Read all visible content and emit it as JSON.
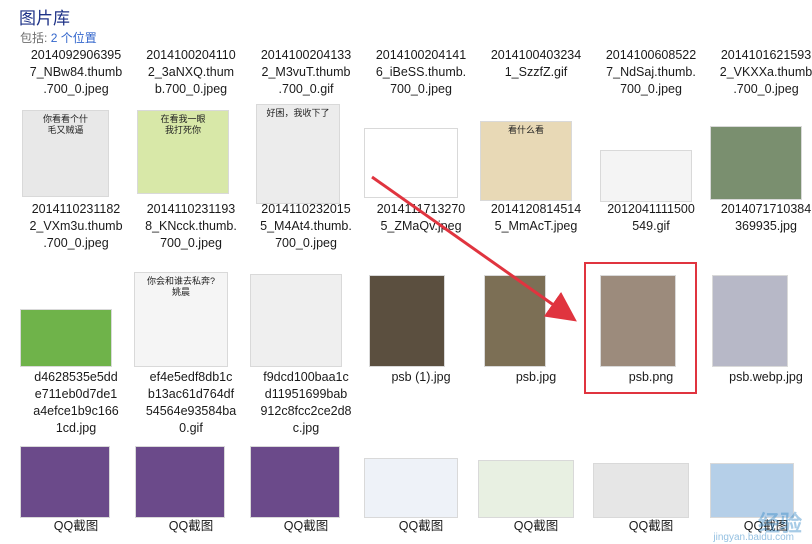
{
  "header": {
    "title": "图片库",
    "includes_prefix": "包括:",
    "includes_link": "2 个位置"
  },
  "row1": [
    {
      "caption": "2014092906395\n7_NBw84.thumb\n.700_0.jpeg"
    },
    {
      "caption": "2014100204110\n2_3aNXQ.thum\nb.700_0.jpeg"
    },
    {
      "caption": "2014100204133\n2_M3vuT.thumb\n.700_0.gif"
    },
    {
      "caption": "2014100204141\n6_iBeSS.thumb.\n700_0.jpeg"
    },
    {
      "caption": "2014100403234\n1_SzzfZ.gif"
    },
    {
      "caption": "2014100608522\n7_NdSaj.thumb.\n700_0.jpeg"
    },
    {
      "caption": "2014101621593\n2_VKXXa.thumb\n.700_0.jpeg"
    }
  ],
  "row2": [
    {
      "caption": "2014110231182\n2_VXm3u.thumb\n.700_0.jpeg",
      "text": "你看看个什\n毛又贼逼"
    },
    {
      "caption": "2014110231193\n8_KNcck.thumb.\n700_0.jpeg",
      "text": "在看我一眼\n我打死你"
    },
    {
      "caption": "2014110232015\n5_M4At4.thumb.\n700_0.jpeg",
      "text": "好困，我收下了"
    },
    {
      "caption": "2014111713270\n5_ZMaQv.jpeg",
      "text": ""
    },
    {
      "caption": "2014120814514\n5_MmAcT.jpeg",
      "text": "看什么看"
    },
    {
      "caption": "2012041111500\n549.gif",
      "text": ""
    },
    {
      "caption": "2014071710384\n369935.jpg",
      "text": ""
    }
  ],
  "row3": [
    {
      "caption": "d4628535e5dd\ne711eb0d7de1\na4efce1b9c166\n1cd.jpg",
      "text": ""
    },
    {
      "caption": "ef4e5edf8db1c\nb13ac61d764df\n54564e93584ba\n0.gif",
      "text": "你会和谁去私奔?\n姚晨"
    },
    {
      "caption": "f9dcd100baa1c\nd11951699bab\n912c8fcc2ce2d8\nc.jpg",
      "text": ""
    },
    {
      "caption": "psb (1).jpg",
      "text": ""
    },
    {
      "caption": "psb.jpg",
      "text": ""
    },
    {
      "caption": "psb.png",
      "text": ""
    },
    {
      "caption": "psb.webp.jpg",
      "text": ""
    }
  ],
  "row4": [
    {
      "caption": "QQ截图"
    },
    {
      "caption": "QQ截图"
    },
    {
      "caption": "QQ截图"
    },
    {
      "caption": "QQ截图"
    },
    {
      "caption": "QQ截图"
    },
    {
      "caption": "QQ截图"
    },
    {
      "caption": "QQ截图"
    }
  ],
  "watermark": {
    "text": "经验",
    "url": "jingyan.baidu.com"
  },
  "colors": {
    "title": "#1e3287",
    "selection": "#e0343f",
    "arrow": "#e0343f",
    "link": "#3366cc"
  }
}
